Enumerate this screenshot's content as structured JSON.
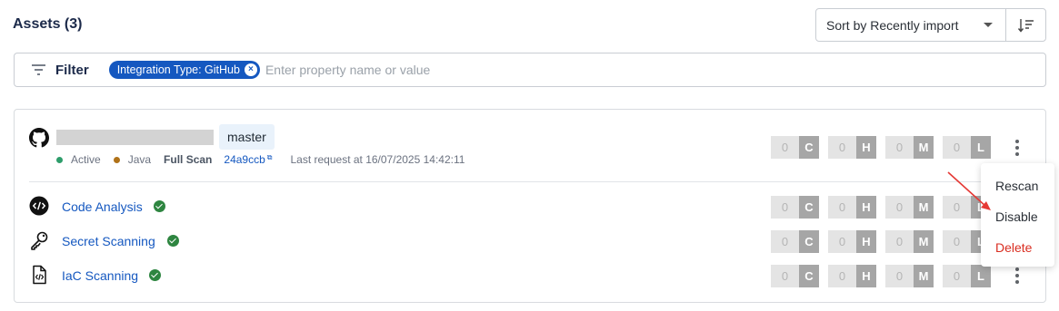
{
  "header": {
    "title": "Assets (3)",
    "sort": {
      "label": "Sort by Recently import",
      "direction_icon": "sort-descending-icon"
    }
  },
  "filter": {
    "label": "Filter",
    "chip": "Integration Type: GitHub",
    "chip_remove": "×",
    "placeholder": "Enter property name or value"
  },
  "asset": {
    "provider_icon": "github-icon",
    "name_redacted": true,
    "branch": "master",
    "status": {
      "label": "Active",
      "color": "#2e9d6b"
    },
    "language": {
      "label": "Java",
      "color": "#b07219"
    },
    "scan_type": "Full Scan",
    "commit": "24a9ccb",
    "commit_link_icon": "external-link-icon",
    "last_request": "Last request at 16/07/2025 14:42:11",
    "severity": [
      {
        "count": "0",
        "letter": "C"
      },
      {
        "count": "0",
        "letter": "H"
      },
      {
        "count": "0",
        "letter": "M"
      },
      {
        "count": "0",
        "letter": "L"
      }
    ]
  },
  "scans": [
    {
      "name": "Code Analysis",
      "icon": "code-icon",
      "status": "success",
      "severity": [
        {
          "count": "0",
          "letter": "C"
        },
        {
          "count": "0",
          "letter": "H"
        },
        {
          "count": "0",
          "letter": "M"
        },
        {
          "count": "0",
          "letter": "L"
        }
      ]
    },
    {
      "name": "Secret Scanning",
      "icon": "key-icon",
      "status": "success",
      "severity": [
        {
          "count": "0",
          "letter": "C"
        },
        {
          "count": "0",
          "letter": "H"
        },
        {
          "count": "0",
          "letter": "M"
        },
        {
          "count": "0",
          "letter": "L"
        }
      ]
    },
    {
      "name": "IaC Scanning",
      "icon": "code-file-icon",
      "status": "success",
      "severity": [
        {
          "count": "0",
          "letter": "C"
        },
        {
          "count": "0",
          "letter": "H"
        },
        {
          "count": "0",
          "letter": "M"
        },
        {
          "count": "0",
          "letter": "L"
        }
      ]
    }
  ],
  "menu": {
    "items": [
      {
        "label": "Rescan"
      },
      {
        "label": "Disable"
      },
      {
        "label": "Delete",
        "danger": true
      }
    ]
  },
  "colors": {
    "accent": "#1558c0",
    "title": "#1c2a4a",
    "success": "#2e8540",
    "danger": "#d92d20",
    "annotation_arrow": "#e53935"
  }
}
